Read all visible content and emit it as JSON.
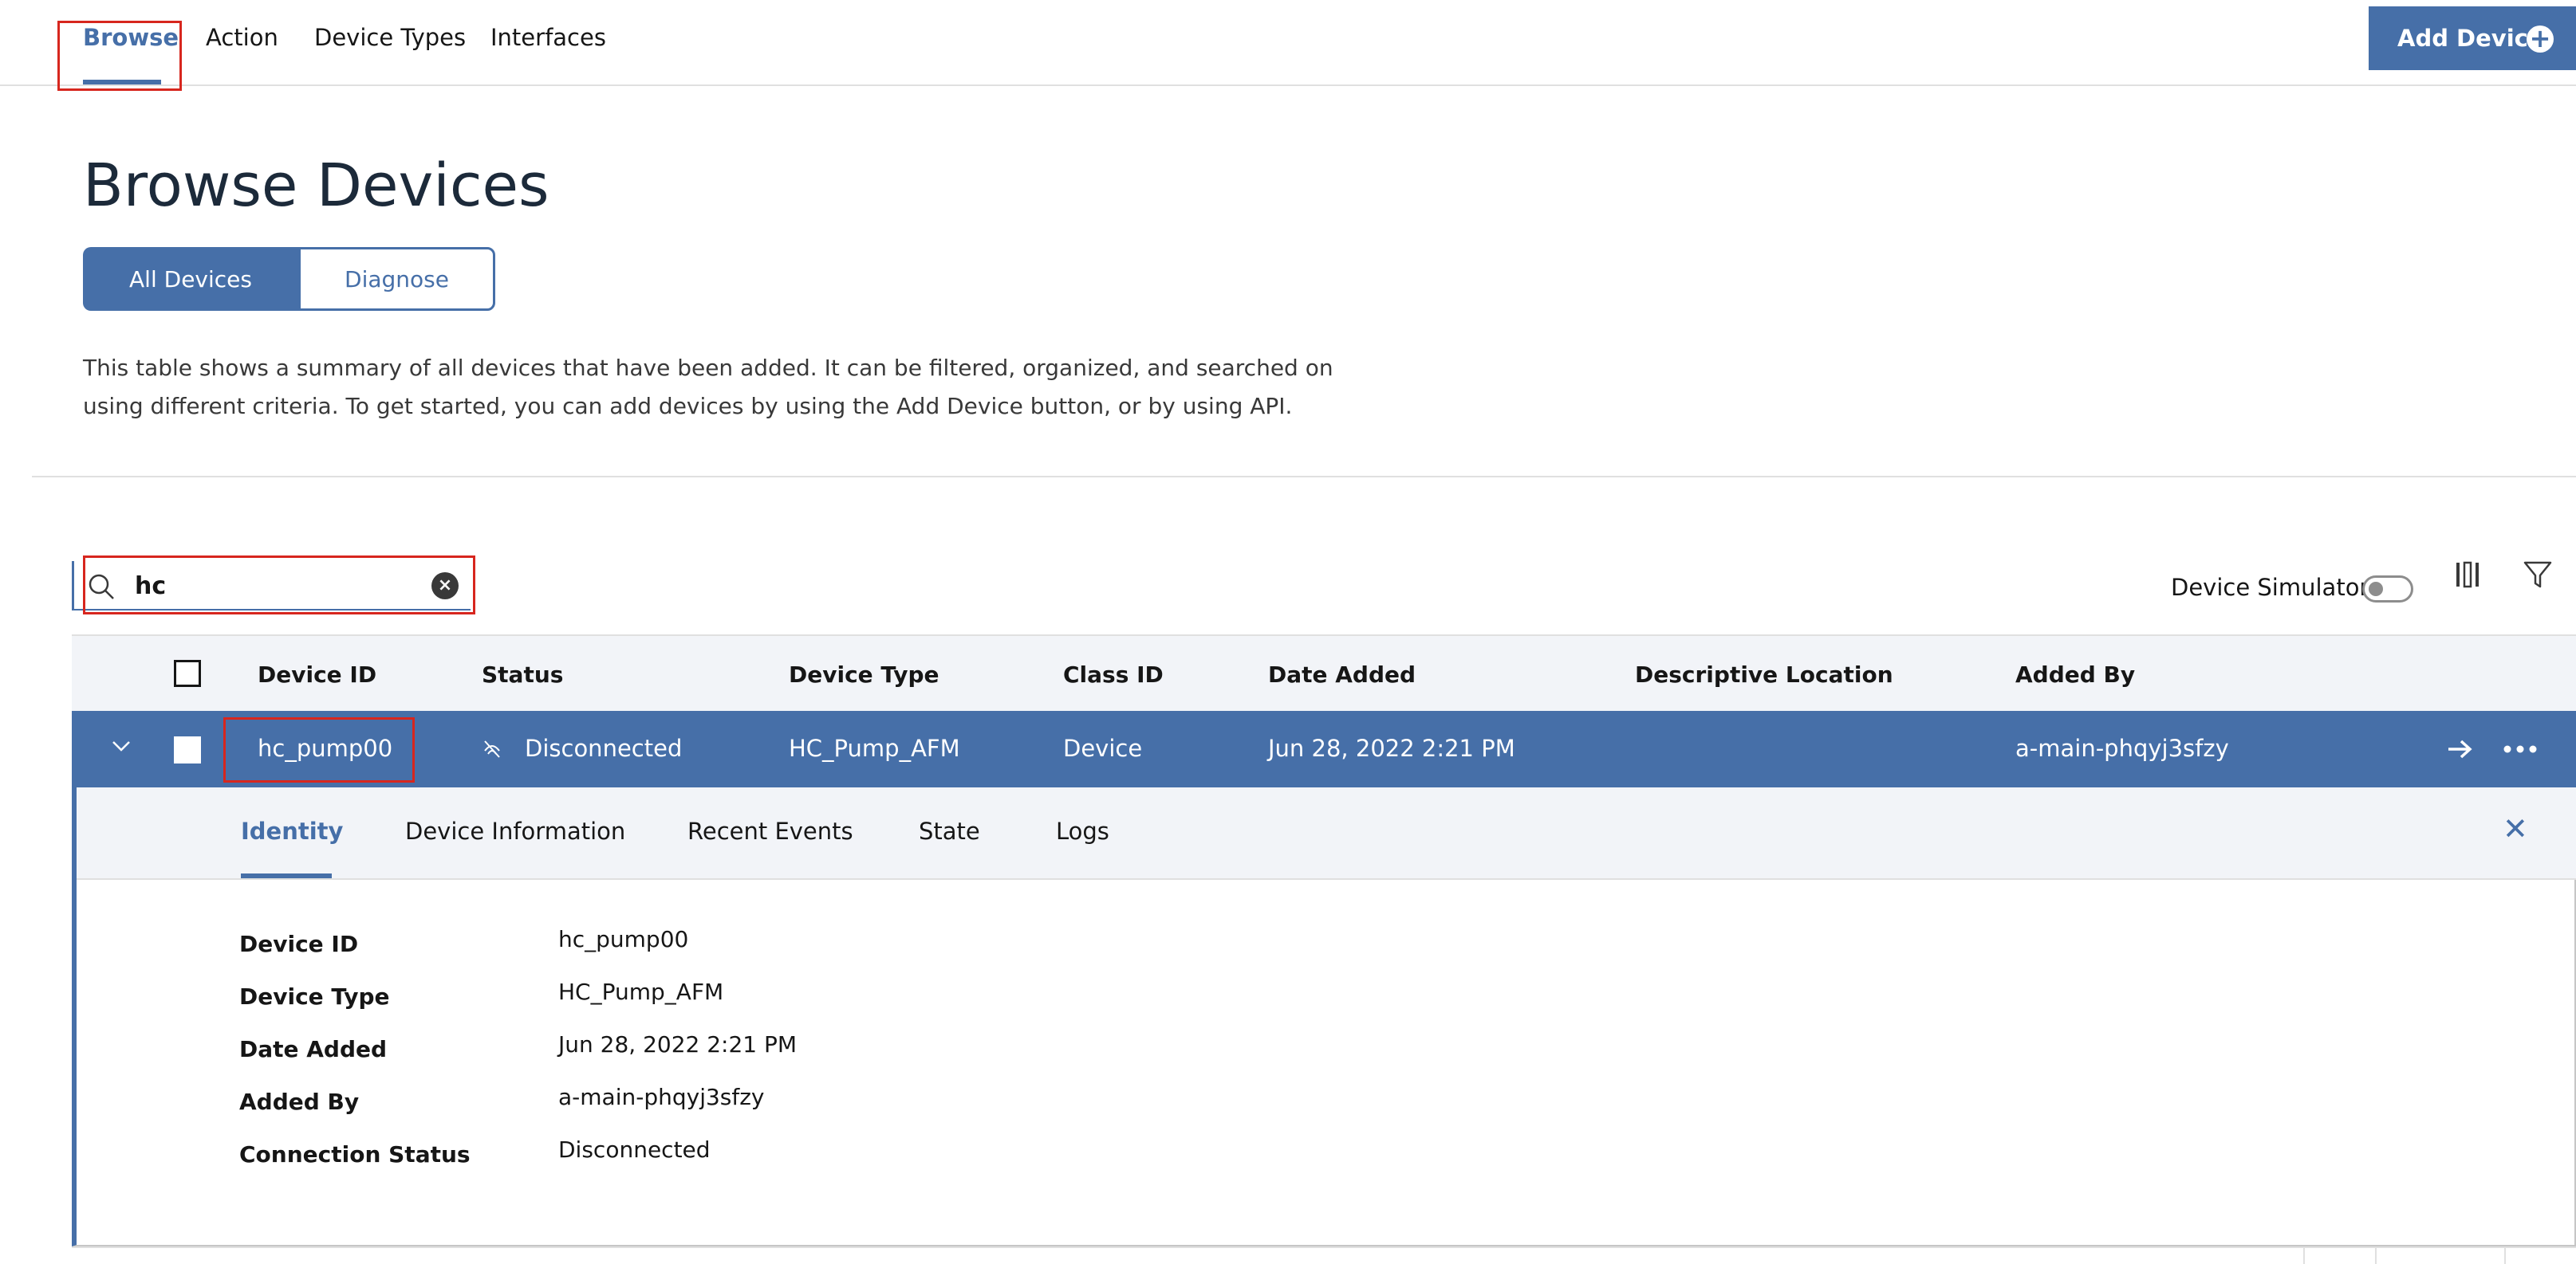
{
  "nav": {
    "tabs": [
      {
        "label": "Browse",
        "active": true
      },
      {
        "label": "Action"
      },
      {
        "label": "Device Types"
      },
      {
        "label": "Interfaces"
      }
    ],
    "add_device_label": "Add Device",
    "accent_color": "#466fa8"
  },
  "header": {
    "title": "Browse Devices",
    "segments": [
      "All Devices",
      "Diagnose"
    ],
    "description": "This table shows a summary of all devices that have been added. It can be filtered, organized, and searched on using different criteria. To get started, you can add devices by using the Add Device button, or by using API."
  },
  "toolbar": {
    "search_value": "hc",
    "device_simulator_label": "Device Simulator",
    "device_simulator_on": false
  },
  "table": {
    "columns": [
      "Device ID",
      "Status",
      "Device Type",
      "Class ID",
      "Date Added",
      "Descriptive Location",
      "Added By"
    ],
    "rows": [
      {
        "device_id": "hc_pump00",
        "status": "Disconnected",
        "device_type": "HC_Pump_AFM",
        "class_id": "Device",
        "date_added": "Jun 28, 2022 2:21 PM",
        "descriptive_location": "",
        "added_by": "a-main-phqyj3sfzy"
      }
    ]
  },
  "detail": {
    "tabs": [
      "Identity",
      "Device Information",
      "Recent Events",
      "State",
      "Logs"
    ],
    "fields": [
      {
        "key": "Device ID",
        "value": "hc_pump00"
      },
      {
        "key": "Device Type",
        "value": "HC_Pump_AFM"
      },
      {
        "key": "Date Added",
        "value": "Jun 28, 2022 2:21 PM"
      },
      {
        "key": "Added By",
        "value": "a-main-phqyj3sfzy"
      },
      {
        "key": "Connection Status",
        "value": "Disconnected"
      }
    ]
  }
}
